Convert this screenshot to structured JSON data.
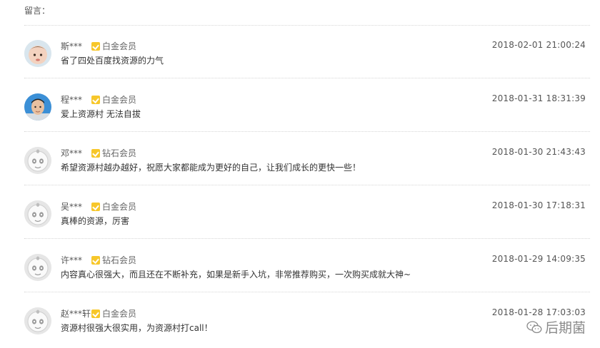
{
  "header": {
    "title": "留言："
  },
  "comments": [
    {
      "name": "斯***",
      "badge": "白金会员",
      "text": "省了四处百度找资源的力气",
      "time": "2018-02-01 21:00:24",
      "avatar": "photo-baby"
    },
    {
      "name": "程***",
      "badge": "白金会员",
      "text": "爱上资源村 无法自拔",
      "time": "2018-01-31 18:31:39",
      "avatar": "photo-man"
    },
    {
      "name": "邓***",
      "badge": "钻石会员",
      "text": "希望资源村越办越好，祝愿大家都能成为更好的自己，让我们成长的更快一些！",
      "time": "2018-01-30 21:43:43",
      "avatar": "default-panda"
    },
    {
      "name": "吴***",
      "badge": "白金会员",
      "text": "真棒的资源，厉害",
      "time": "2018-01-30 17:18:31",
      "avatar": "default-panda"
    },
    {
      "name": "许***",
      "badge": "钻石会员",
      "text": "内容真心很强大，而且还在不断补充，如果是新手入坑，非常推荐购买，一次购买成就大神~",
      "time": "2018-01-29 14:09:35",
      "avatar": "default-panda"
    },
    {
      "name": "赵***轩",
      "badge": "白金会员",
      "text": "资源村很强大很实用，为资源村打call！",
      "time": "2018-01-28 17:03:03",
      "avatar": "default-panda"
    }
  ],
  "watermark": {
    "text": "后期菌",
    "icon": "wechat-icon"
  },
  "colors": {
    "badge_icon": "#f7c72a",
    "divider": "#d6d6d6"
  }
}
